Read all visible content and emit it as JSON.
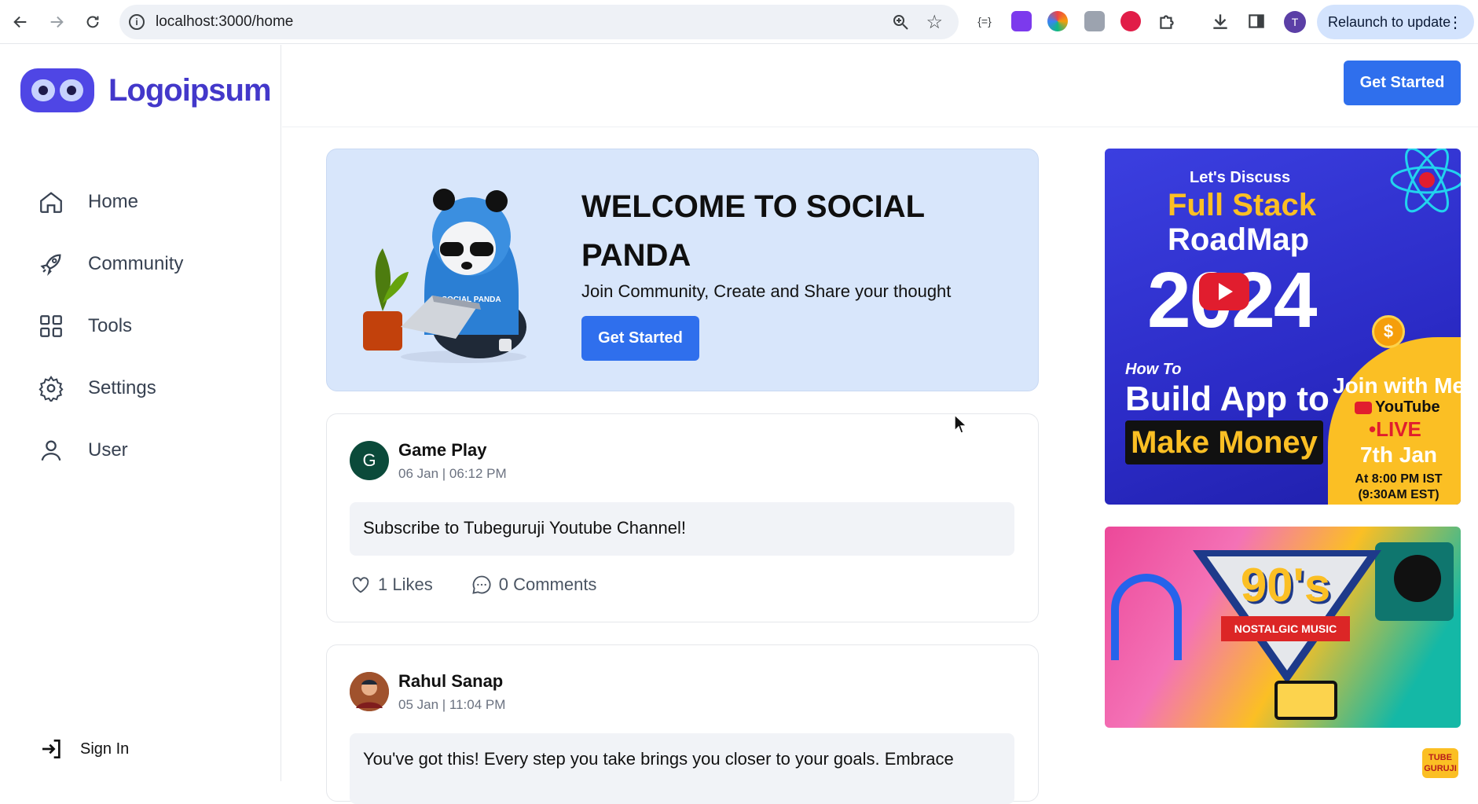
{
  "browser": {
    "url": "localhost:3000/home",
    "relaunch_label": "Relaunch to update",
    "profile_initial": "T"
  },
  "sidebar": {
    "logo_text": "Logoipsum",
    "items": [
      {
        "label": "Home",
        "icon": "home-icon"
      },
      {
        "label": "Community",
        "icon": "rocket-icon"
      },
      {
        "label": "Tools",
        "icon": "grid-icon"
      },
      {
        "label": "Settings",
        "icon": "gear-icon"
      },
      {
        "label": "User",
        "icon": "user-icon"
      }
    ],
    "signin_label": "Sign In"
  },
  "header": {
    "cta_label": "Get Started"
  },
  "hero": {
    "title": "WELCOME TO SOCIAL PANDA",
    "subtitle": "Join Community, Create and Share your thought",
    "cta_label": "Get Started",
    "shirt_text": "SOCIAL PANDA"
  },
  "posts": [
    {
      "avatar_initial": "G",
      "author": "Game Play",
      "time": "06 Jan | 06:12 PM",
      "content": "Subscribe to Tubeguruji Youtube Channel!",
      "likes": "1 Likes",
      "comments": "0 Comments"
    },
    {
      "author": "Rahul Sanap",
      "time": "05 Jan | 11:04 PM",
      "content": "You've got this! Every step you take brings you closer to your goals. Embrace"
    }
  ],
  "ads": {
    "ad1": {
      "lets_discuss": "Let's Discuss",
      "line1": "Full Stack",
      "line2": "RoadMap",
      "year": "2024",
      "how_to": "How To",
      "build": "Build App to",
      "money": "Make Money",
      "join": "Join with Me",
      "youtube": "YouTube",
      "live": "•LIVE",
      "date": "7th Jan",
      "time_ist": "At 8:00 PM IST",
      "time_est": "(9:30AM EST)"
    },
    "ad2": {
      "headline": "90's",
      "band": "NOSTALGIC MUSIC"
    }
  },
  "watermark": "TUBE GURUJI",
  "colors": {
    "brand": "#4f46e5",
    "primary_button": "#2f6fed",
    "hero_bg": "#d8e6fb"
  }
}
